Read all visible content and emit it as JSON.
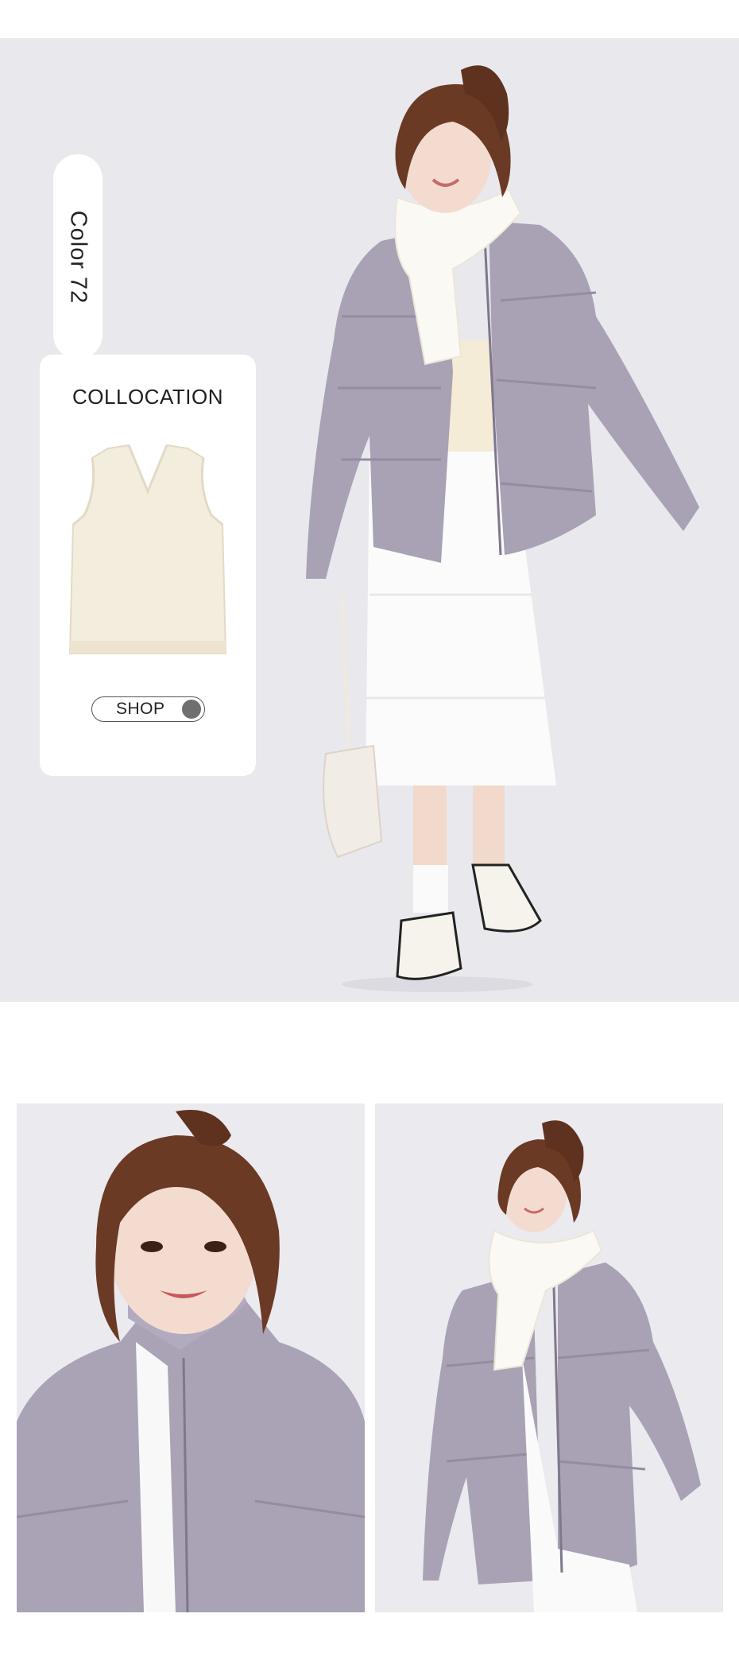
{
  "hero": {
    "color_label": "Color 72",
    "collocation": {
      "title": "COLLOCATION",
      "shop_label": "SHOP"
    }
  },
  "colors": {
    "background": "#e9e8ed",
    "jacket": "#a9a1b4",
    "card": "#ffffff",
    "vest": "#f3eddd"
  }
}
